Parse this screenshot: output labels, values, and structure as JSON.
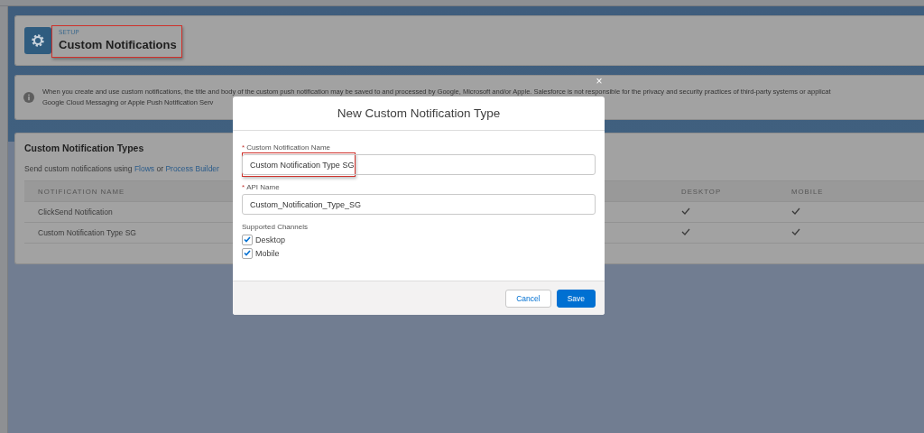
{
  "header": {
    "eyebrow": "SETUP",
    "title": "Custom Notifications",
    "highlighted": true
  },
  "info": {
    "lines": [
      "When you create and use custom notifications, the title and body of the custom push notification may be saved to and processed by Google, Microsoft and/or Apple. Salesforce is not responsible for the privacy and security practices of third-party systems or applicat",
      "Google Cloud Messaging or Apple Push Notification Serv"
    ]
  },
  "types_card": {
    "title": "Custom Notification Types",
    "intro": [
      {
        "kind": "text",
        "text": "Send custom notifications using "
      },
      {
        "kind": "link",
        "text": "Flows"
      },
      {
        "kind": "text",
        "text": " or "
      },
      {
        "kind": "link",
        "text": "Process Builder"
      }
    ],
    "table": {
      "columns": [
        "NOTIFICATION NAME",
        "DESKTOP",
        "MOBILE"
      ],
      "rows": [
        {
          "name": "ClickSend Notification",
          "desktop": true,
          "mobile": true
        },
        {
          "name": "Custom Notification Type SG",
          "desktop": true,
          "mobile": true
        }
      ]
    }
  },
  "modal": {
    "close": "×",
    "title": "New Custom Notification Type",
    "fields": [
      {
        "label": "Custom Notification Name",
        "required_mark": "*",
        "value": "Custom Notification Type SG",
        "highlighted": true
      },
      {
        "label": "API Name",
        "required_mark": "*",
        "value": "Custom_Notification_Type_SG"
      }
    ],
    "channels_label": "Supported Channels",
    "channels": [
      {
        "label": "Desktop",
        "checked": true
      },
      {
        "label": "Mobile",
        "checked": true
      }
    ],
    "buttons": [
      {
        "label": "Cancel",
        "kind": "neutral"
      },
      {
        "label": "Save",
        "kind": "brand"
      }
    ]
  }
}
